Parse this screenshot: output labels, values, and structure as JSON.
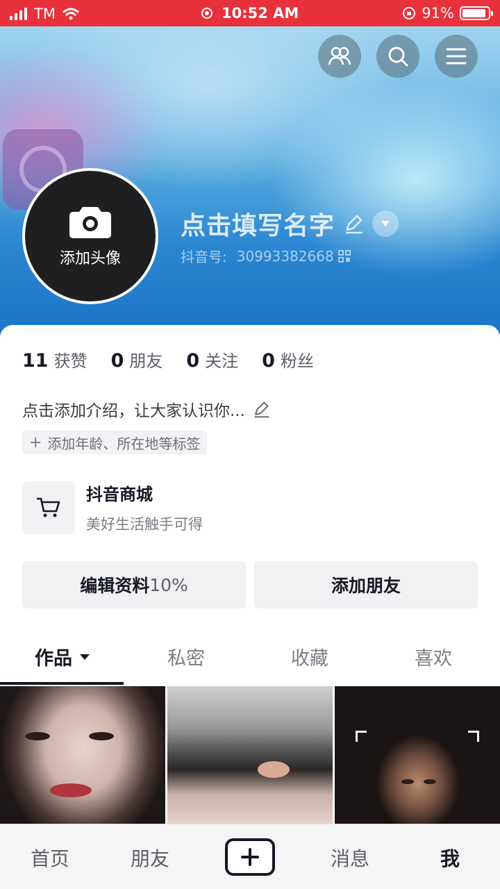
{
  "status_bar": {
    "carrier": "TM",
    "time": "10:52 AM",
    "battery": "91%",
    "battery_level": 0.91,
    "bar_color": "#e8313a"
  },
  "header": {
    "icons": [
      "friends-icon",
      "search-icon",
      "menu-icon"
    ],
    "avatar_label": "添加头像",
    "name": "点击填写名字",
    "id_label": "抖音号:",
    "id_value": "30993382668"
  },
  "stats": [
    {
      "num": "11",
      "label": "获赞"
    },
    {
      "num": "0",
      "label": "朋友"
    },
    {
      "num": "0",
      "label": "关注"
    },
    {
      "num": "0",
      "label": "粉丝"
    }
  ],
  "bio": "点击添加介绍，让大家认识你...",
  "tag": "添加年龄、所在地等标签",
  "shop": {
    "title": "抖音商城",
    "subtitle": "美好生活触手可得"
  },
  "buttons": {
    "edit_label": "编辑资料",
    "edit_progress": "10%",
    "add_friend": "添加朋友"
  },
  "tabs": [
    "作品",
    "私密",
    "收藏",
    "喜欢"
  ],
  "bottom_nav": {
    "home": "首页",
    "friends": "朋友",
    "messages": "消息",
    "me": "我"
  }
}
